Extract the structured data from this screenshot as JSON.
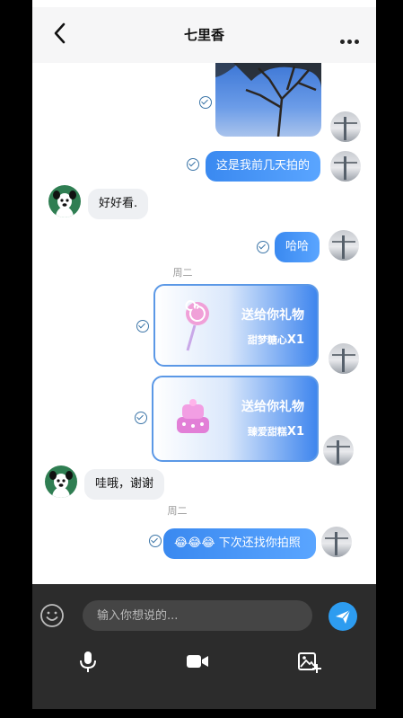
{
  "header": {
    "title": "七里香",
    "back_icon": "chevron-left-icon",
    "more_icon": "more-dots-icon"
  },
  "messages": [
    {
      "from": "me",
      "type": "image",
      "status": "read"
    },
    {
      "from": "me",
      "type": "text",
      "text": "这是我前几天拍的",
      "status": "read"
    },
    {
      "from": "other",
      "type": "text",
      "text": "好好看."
    },
    {
      "from": "me",
      "type": "text",
      "text": "哈哈",
      "status": "read"
    },
    {
      "day": "周二"
    },
    {
      "from": "me",
      "type": "gift",
      "title": "送给你礼物",
      "item": "甜梦糖心",
      "count": "X1",
      "status": "read"
    },
    {
      "from": "me",
      "type": "gift",
      "title": "送给你礼物",
      "item": "臻爱甜糕",
      "count": "X1",
      "status": "read"
    },
    {
      "from": "other",
      "type": "text",
      "text": "哇哦，谢谢"
    },
    {
      "day": "周二"
    },
    {
      "from": "me",
      "type": "text",
      "text": "😂😂😂 下次还找你拍照",
      "status": "read"
    }
  ],
  "composer": {
    "placeholder": "输入你想说的...",
    "emoji_icon": "smiley-icon",
    "send_icon": "send-icon",
    "tools": [
      "microphone-icon",
      "video-camera-icon",
      "image-add-icon"
    ]
  },
  "colors": {
    "accent": "#3a89f0",
    "bubble_in": "#eef0f3",
    "composer_bg": "#2c2c2c",
    "send": "#2d9cf0"
  }
}
